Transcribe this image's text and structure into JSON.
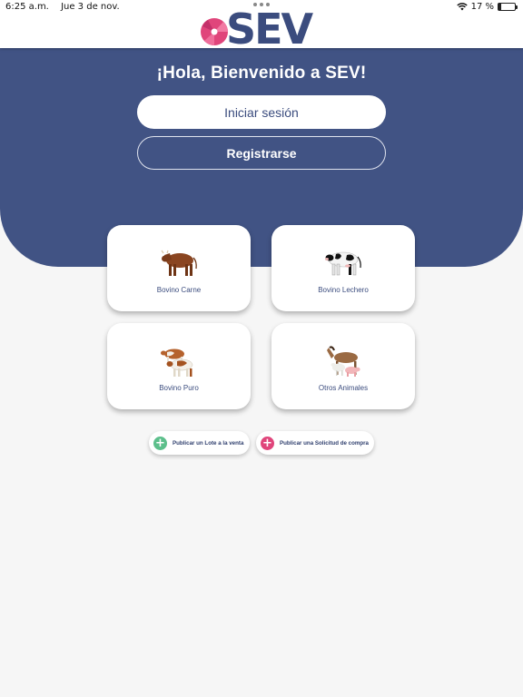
{
  "status_bar": {
    "time": "6:25 a.m.",
    "date": "Jue 3 de nov.",
    "battery": "17 %",
    "battery_level": 0.17
  },
  "header": {
    "logo_text": "SEV",
    "colors": {
      "brand_blue": "#3b4c7e",
      "brand_pink": "#e0457b"
    }
  },
  "hero": {
    "title": "¡Hola, Bienvenido a SEV!",
    "login_label": "Iniciar sesión",
    "register_label": "Registrarse",
    "background": "#415384"
  },
  "categories": [
    {
      "label": "Bovino Carne",
      "icon": "brown-cow-icon"
    },
    {
      "label": "Bovino Lechero",
      "icon": "dairy-cow-icon"
    },
    {
      "label": "Bovino Puro",
      "icon": "cattle-pair-icon"
    },
    {
      "label": "Otros Animales",
      "icon": "farm-animals-icon"
    }
  ],
  "actions": {
    "publish_lot": "Publicar un Lote a la venta",
    "publish_request": "Publicar una Solicitud de compra"
  }
}
